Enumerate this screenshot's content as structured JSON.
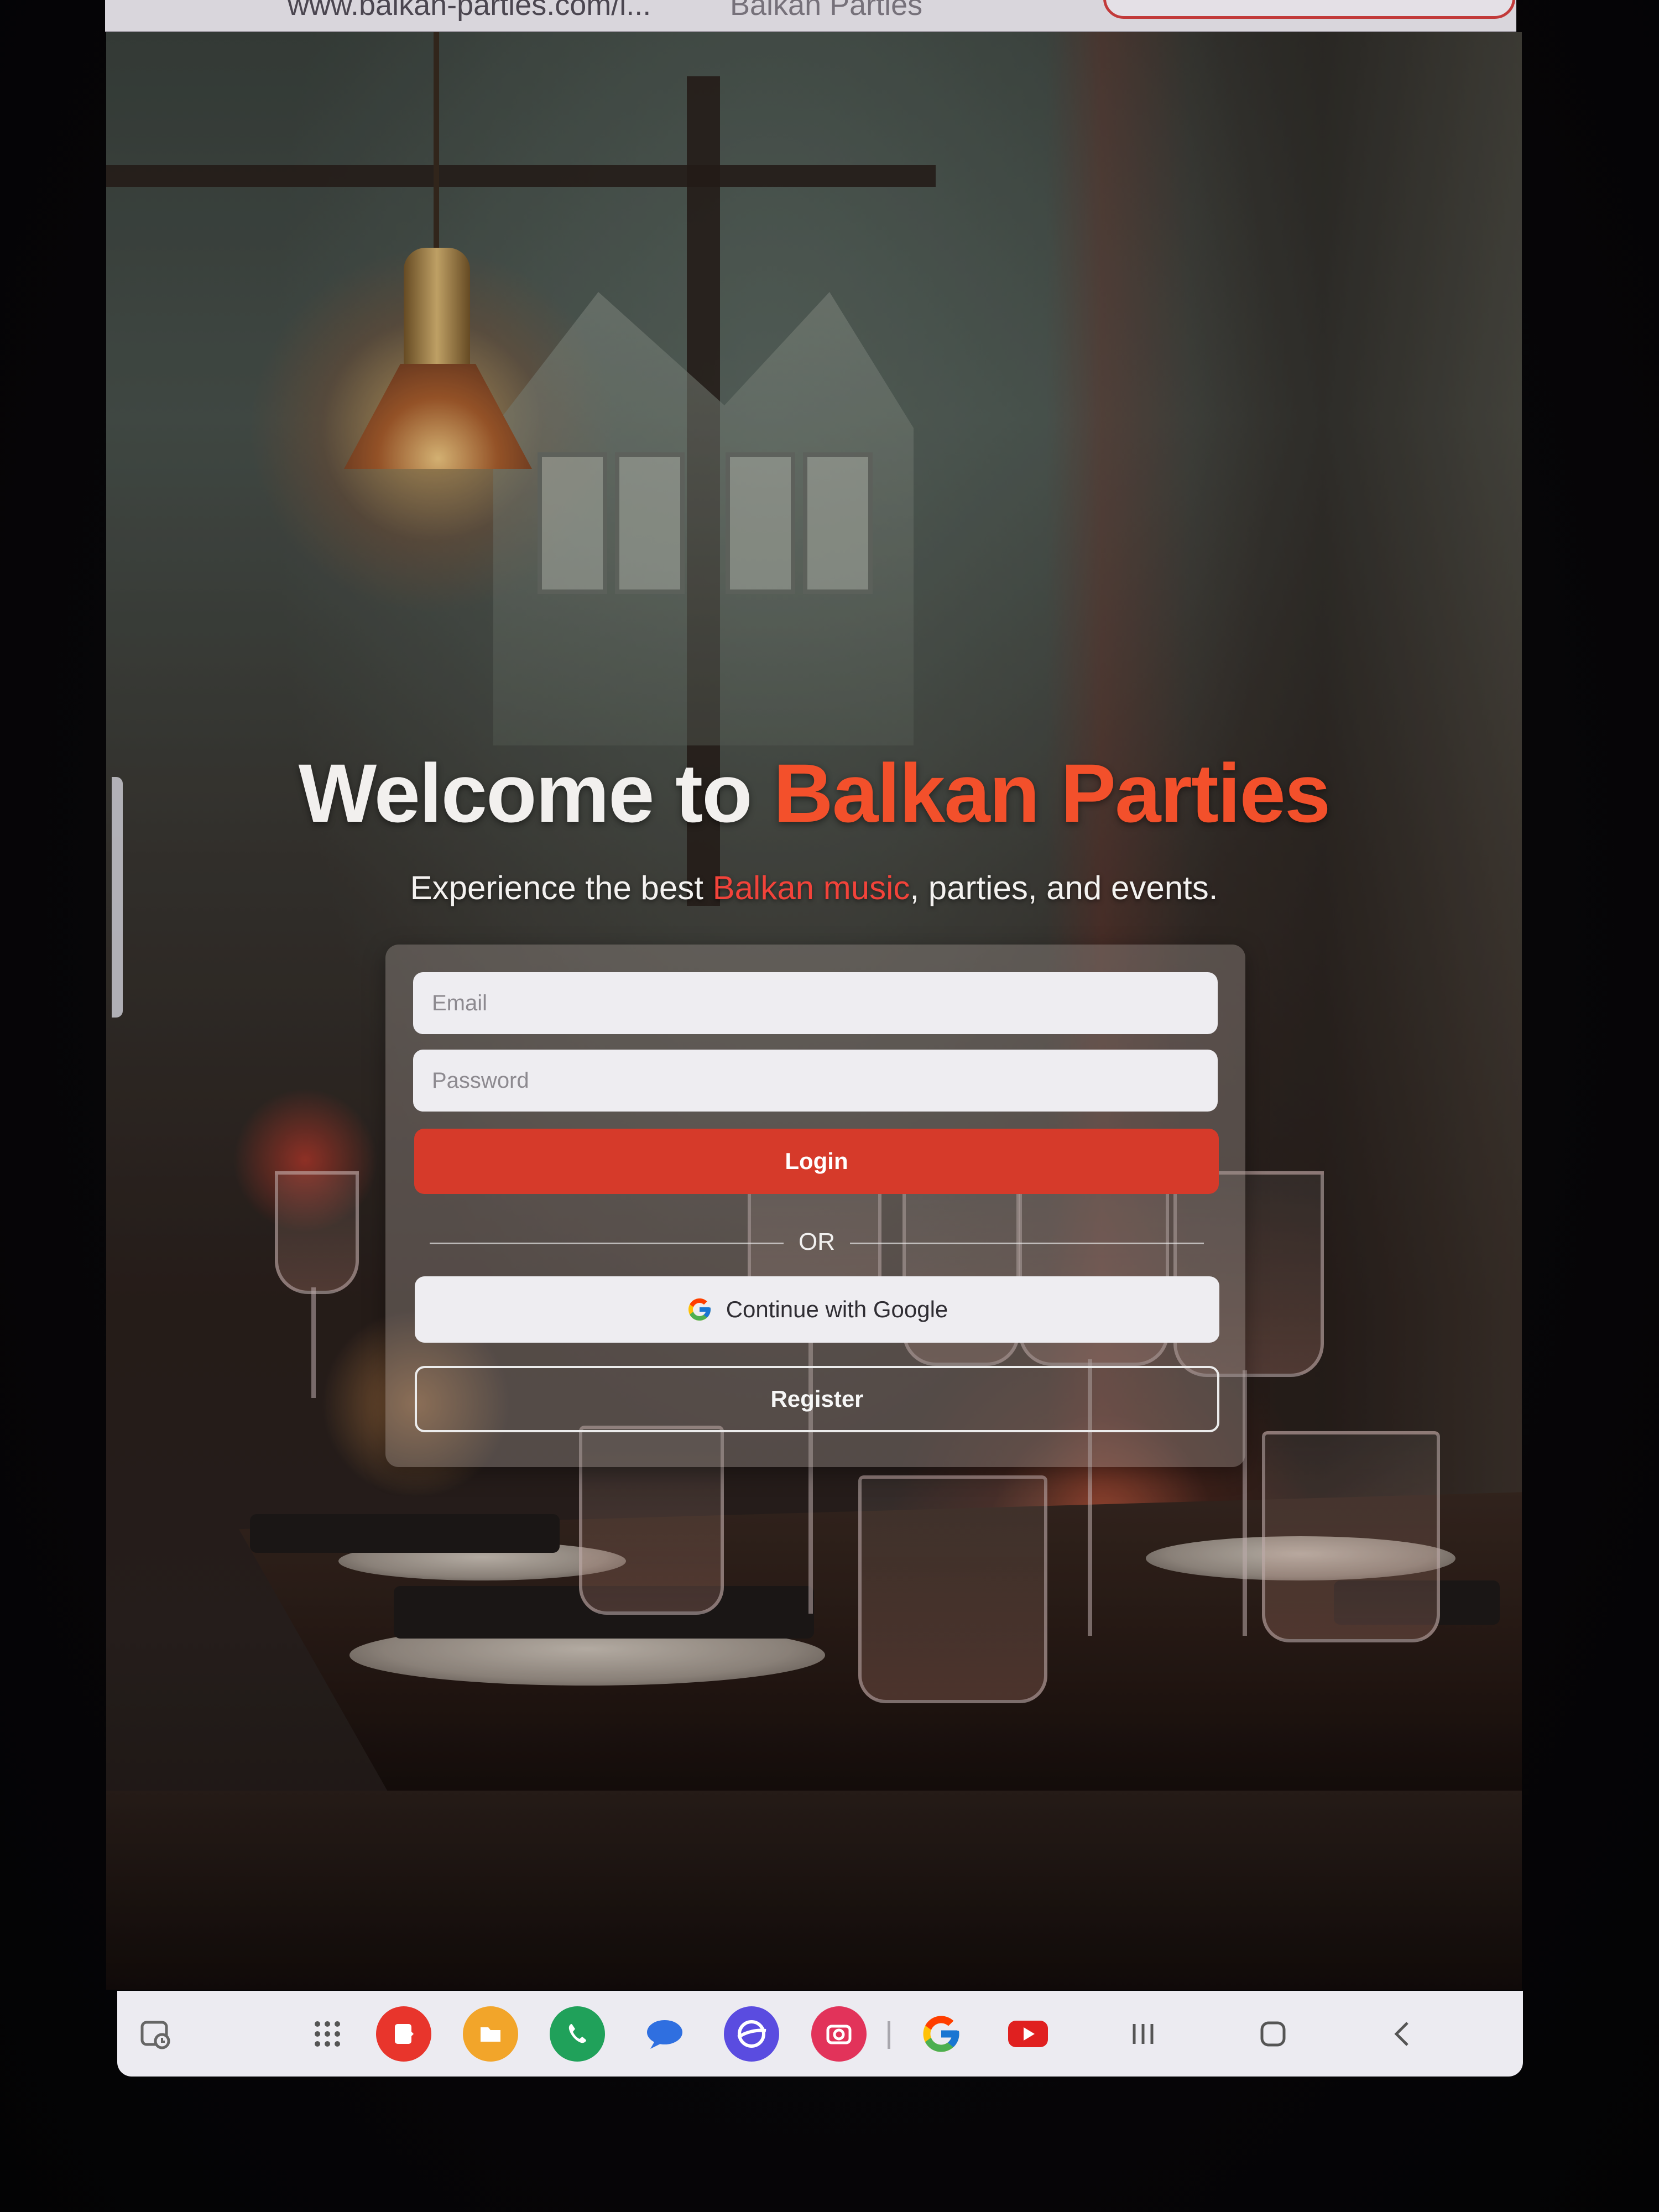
{
  "browser": {
    "url": "www.balkan-parties.com/i...",
    "tab_title": "Balkan Parties"
  },
  "hero": {
    "title_prefix": "Welcome to ",
    "title_accent": "Balkan Parties",
    "subtitle_prefix": "Experience the best ",
    "subtitle_accent": "Balkan music",
    "subtitle_suffix": ", parties, and events."
  },
  "login_form": {
    "email_placeholder": "Email",
    "password_placeholder": "Password",
    "login_label": "Login",
    "divider_label": "OR",
    "google_label": "Continue with Google",
    "register_label": "Register"
  },
  "taskbar": {
    "items": [
      {
        "icon": "recent-apps-history-icon"
      },
      {
        "icon": "app-drawer-icon"
      },
      {
        "icon": "samsung-notes-icon",
        "color": "#e8352c"
      },
      {
        "icon": "my-files-folder-icon",
        "color": "#f2a52a"
      },
      {
        "icon": "phone-icon",
        "color": "#20a15a"
      },
      {
        "icon": "messages-icon",
        "color": "#2f6fe0"
      },
      {
        "icon": "samsung-internet-icon",
        "color": "#5a4ce0"
      },
      {
        "icon": "camera-icon",
        "color": "#e2335a"
      },
      {
        "icon": "google-icon"
      },
      {
        "icon": "youtube-icon",
        "color": "#e02020"
      },
      {
        "icon": "nav-recents-icon"
      },
      {
        "icon": "nav-home-icon"
      },
      {
        "icon": "nav-back-icon"
      }
    ]
  },
  "colors": {
    "accent": "#f3502b",
    "login_button": "#d63a2a",
    "input_bg": "#eeedf1"
  }
}
